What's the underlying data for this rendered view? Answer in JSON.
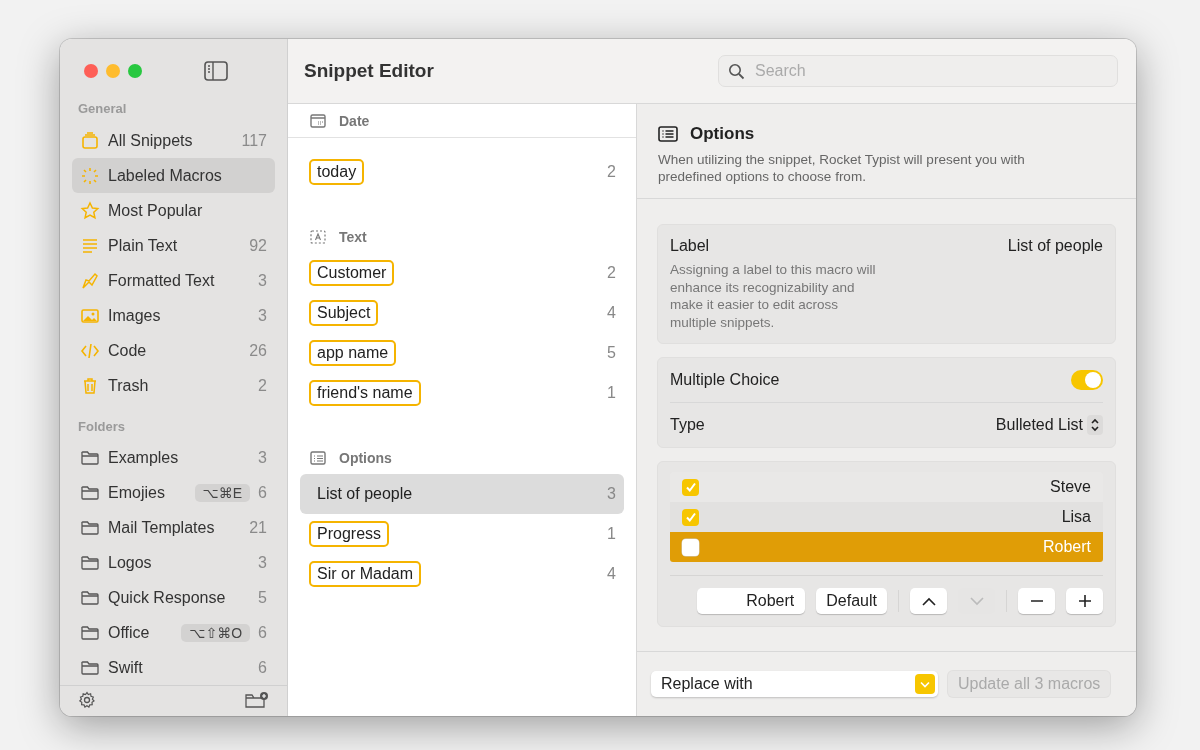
{
  "window": {
    "title": "Snippet Editor"
  },
  "search": {
    "placeholder": "Search"
  },
  "sidebar": {
    "sections": [
      {
        "title": "General",
        "items": [
          {
            "label": "All Snippets",
            "count": "117",
            "selected": false
          },
          {
            "label": "Labeled Macros",
            "selected": true
          },
          {
            "label": "Most Popular",
            "selected": false
          },
          {
            "label": "Plain Text",
            "count": "92",
            "selected": false
          },
          {
            "label": "Formatted Text",
            "count": "3",
            "selected": false
          },
          {
            "label": "Images",
            "count": "3",
            "selected": false
          },
          {
            "label": "Code",
            "count": "26",
            "selected": false
          },
          {
            "label": "Trash",
            "count": "2",
            "selected": false
          }
        ]
      },
      {
        "title": "Folders",
        "items": [
          {
            "label": "Examples",
            "count": "3",
            "selected": false
          },
          {
            "label": "Emojies",
            "shortcut": "⌥⌘E",
            "count": "6",
            "selected": false
          },
          {
            "label": "Mail Templates",
            "count": "21",
            "selected": false
          },
          {
            "label": "Logos",
            "count": "3",
            "selected": false
          },
          {
            "label": "Quick Response",
            "count": "5",
            "selected": false
          },
          {
            "label": "Office",
            "shortcut": "⌥⇧⌘O",
            "count": "6",
            "selected": false
          },
          {
            "label": "Swift",
            "count": "6",
            "selected": false
          }
        ]
      }
    ]
  },
  "macro_groups": [
    {
      "title": "Date",
      "items": [
        {
          "label": "today",
          "count": "2",
          "selected": false
        }
      ]
    },
    {
      "title": "Text",
      "items": [
        {
          "label": "Customer",
          "count": "2",
          "selected": false
        },
        {
          "label": "Subject",
          "count": "4",
          "selected": false
        },
        {
          "label": "app name",
          "count": "5",
          "selected": false
        },
        {
          "label": "friend's name",
          "count": "1",
          "selected": false
        }
      ]
    },
    {
      "title": "Options",
      "items": [
        {
          "label": "List of people",
          "count": "3",
          "selected": true
        },
        {
          "label": "Progress",
          "count": "1",
          "selected": false
        },
        {
          "label": "Sir or Madam",
          "count": "4",
          "selected": false
        }
      ]
    }
  ],
  "details": {
    "title": "Options",
    "description": "When utilizing the snippet, Rocket Typist will present you with predefined options to choose from."
  },
  "label_card": {
    "title": "Label",
    "value": "List of people",
    "description": "Assigning a label to this macro will enhance its recognizability and make it easier to edit across multiple snippets."
  },
  "settings": {
    "multiple_choice": {
      "label": "Multiple Choice",
      "on": true
    },
    "type": {
      "label": "Type",
      "value": "Bulleted List"
    }
  },
  "choices": [
    {
      "label": "Steve",
      "checked": true,
      "selected": false
    },
    {
      "label": "Lisa",
      "checked": true,
      "selected": false
    },
    {
      "label": "Robert",
      "checked": false,
      "selected": true
    }
  ],
  "choice_editor": {
    "value": "Robert",
    "default_button": "Default",
    "move_up_disabled": false,
    "move_down_disabled": true
  },
  "footer": {
    "action": "Replace with",
    "update_button": {
      "label": "Update all 3 macros",
      "disabled": true
    }
  }
}
